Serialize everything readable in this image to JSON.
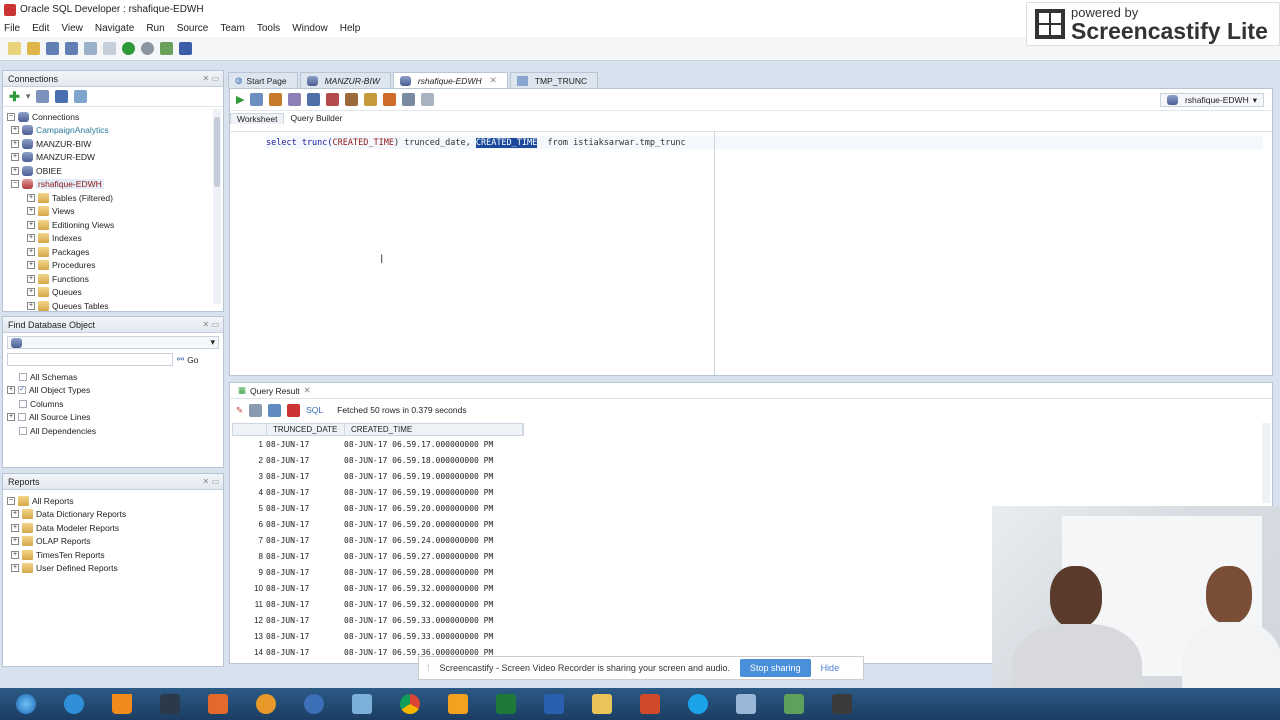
{
  "window": {
    "title": "Oracle SQL Developer : rshafique-EDWH"
  },
  "menu": [
    "File",
    "Edit",
    "View",
    "Navigate",
    "Run",
    "Source",
    "Team",
    "Tools",
    "Window",
    "Help"
  ],
  "overlay": {
    "powered_by": "powered by",
    "name": "Screencastify Lite"
  },
  "connections": {
    "title": "Connections",
    "root": "Connections",
    "items": [
      "CampaignAnalytics",
      "MANZUR-BIW",
      "MANZUR-EDW",
      "OBIEE",
      "rshafique-EDWH"
    ],
    "children": [
      "Tables (Filtered)",
      "Views",
      "Editioning Views",
      "Indexes",
      "Packages",
      "Procedures",
      "Functions",
      "Queues",
      "Queues Tables"
    ]
  },
  "find": {
    "title": "Find Database Object",
    "go_label": "Go",
    "options": [
      "All Schemas",
      "All Object Types",
      "Columns",
      "All Source Lines",
      "All Dependencies"
    ]
  },
  "reports": {
    "title": "Reports",
    "items": [
      "All Reports",
      "Data Dictionary Reports",
      "Data Modeler Reports",
      "OLAP Reports",
      "TimesTen Reports",
      "User Defined Reports"
    ]
  },
  "tabs": [
    "Start Page",
    "MANZUR-BIW",
    "rshafique-EDWH",
    "TMP_TRUNC"
  ],
  "editor": {
    "connection": "rshafique-EDWH",
    "subtabs": [
      "Worksheet",
      "Query Builder"
    ],
    "sql_parts": {
      "p1": "select trunc(",
      "p2": "CREATED_TIME",
      "p3": ") trunced_date, ",
      "p4": "CREATED_TIME",
      "p5": "  from istiaksarwar.tmp_trunc"
    }
  },
  "results": {
    "tab_label": "Query Result",
    "sql_label": "SQL",
    "status": "Fetched 50 rows in 0.379 seconds",
    "columns": [
      "TRUNCED_DATE",
      "CREATED_TIME"
    ],
    "rows": [
      [
        "1",
        "08-JUN-17",
        "08-JUN-17 06.59.17.000000000 PM"
      ],
      [
        "2",
        "08-JUN-17",
        "08-JUN-17 06.59.18.000000000 PM"
      ],
      [
        "3",
        "08-JUN-17",
        "08-JUN-17 06.59.19.000000000 PM"
      ],
      [
        "4",
        "08-JUN-17",
        "08-JUN-17 06.59.19.000000000 PM"
      ],
      [
        "5",
        "08-JUN-17",
        "08-JUN-17 06.59.20.000000000 PM"
      ],
      [
        "6",
        "08-JUN-17",
        "08-JUN-17 06.59.20.000000000 PM"
      ],
      [
        "7",
        "08-JUN-17",
        "08-JUN-17 06.59.24.000000000 PM"
      ],
      [
        "8",
        "08-JUN-17",
        "08-JUN-17 06.59.27.000000000 PM"
      ],
      [
        "9",
        "08-JUN-17",
        "08-JUN-17 06.59.28.000000000 PM"
      ],
      [
        "10",
        "08-JUN-17",
        "08-JUN-17 06.59.32.000000000 PM"
      ],
      [
        "11",
        "08-JUN-17",
        "08-JUN-17 06.59.32.000000000 PM"
      ],
      [
        "12",
        "08-JUN-17",
        "08-JUN-17 06.59.33.000000000 PM"
      ],
      [
        "13",
        "08-JUN-17",
        "08-JUN-17 06.59.33.000000000 PM"
      ],
      [
        "14",
        "08-JUN-17",
        "08-JUN-17 06.59.36.000000000 PM"
      ]
    ]
  },
  "share_bar": {
    "message": "Screencastify - Screen Video Recorder is sharing your screen and audio.",
    "stop_label": "Stop sharing",
    "hide_label": "Hide"
  },
  "taskbar": [
    "start-orb",
    "internet-explorer",
    "vlc",
    "lightroom",
    "apps-grid",
    "media-player",
    "r-studio",
    "sql-developer",
    "chrome",
    "outlook",
    "excel",
    "word",
    "file-explorer",
    "powerpoint",
    "skype",
    "snipping-tool",
    "camtasia",
    "screencastify"
  ]
}
